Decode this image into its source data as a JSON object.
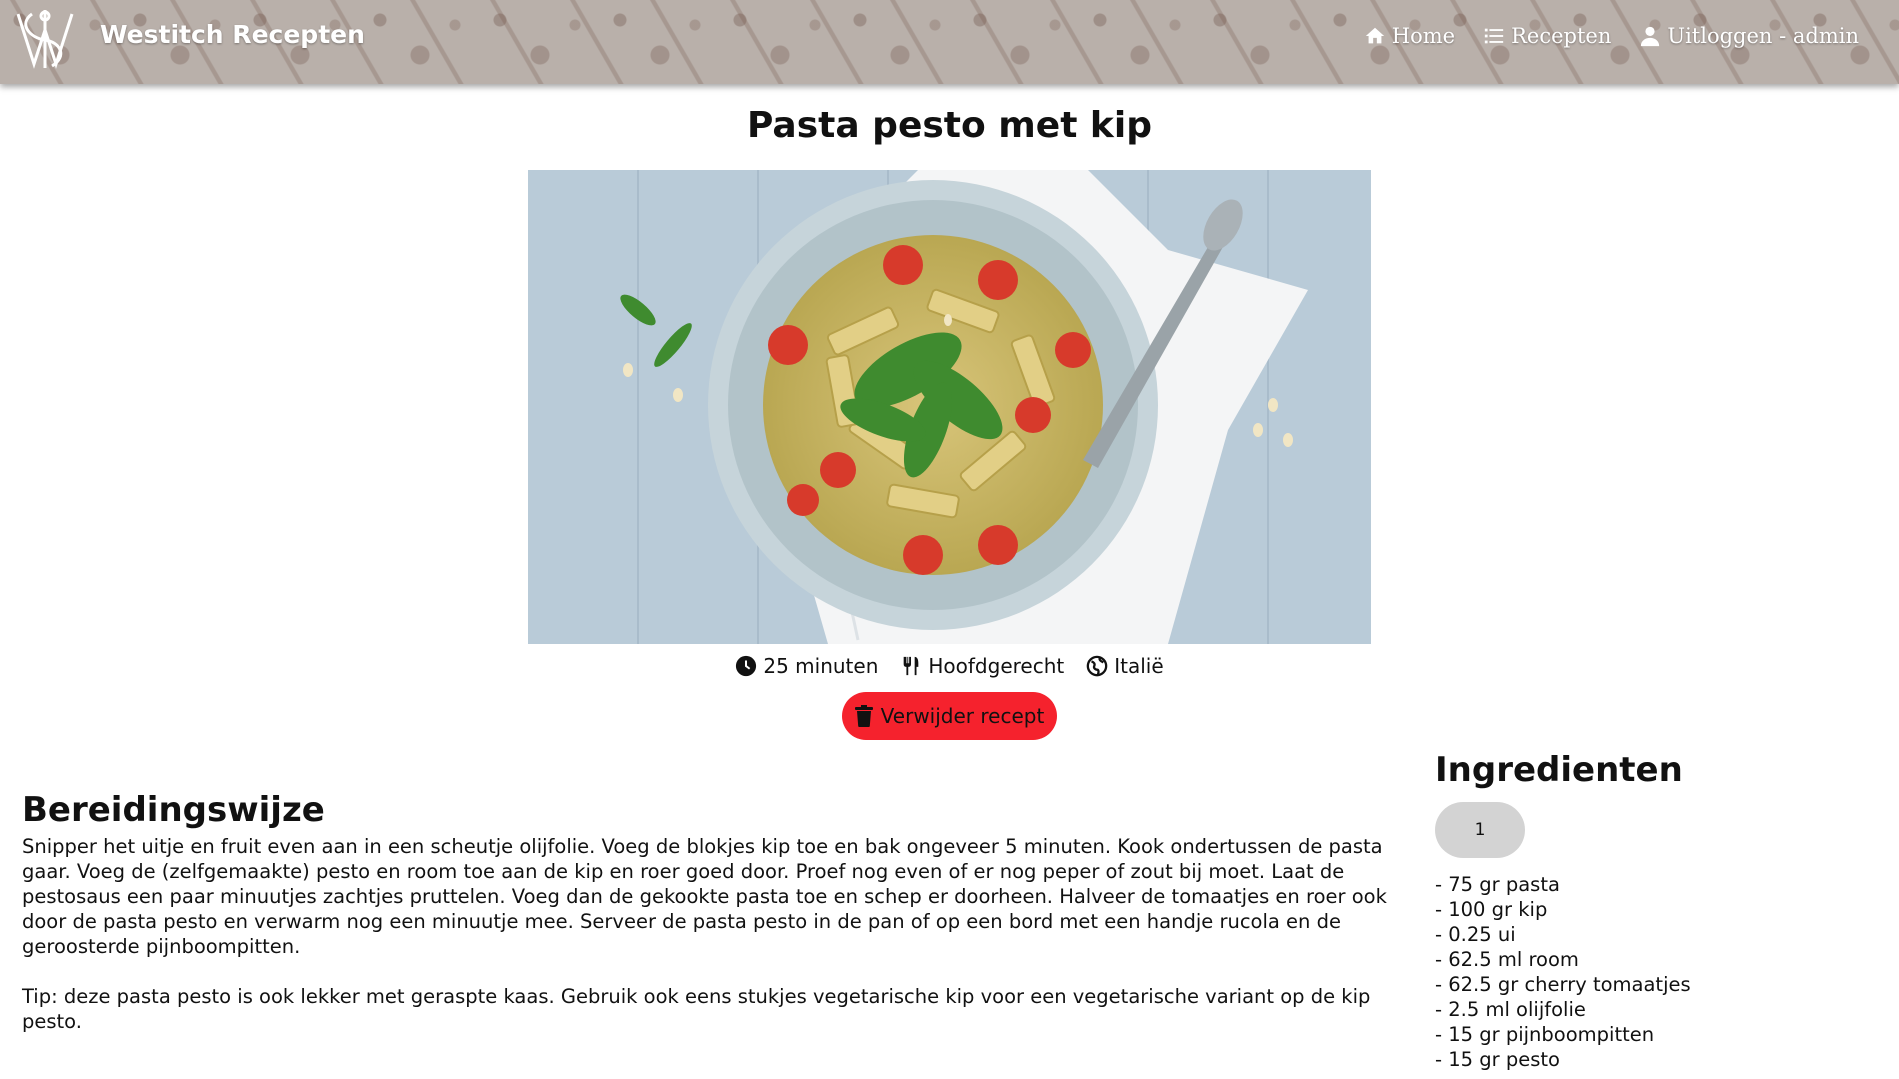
{
  "header": {
    "brand": "Westitch Recepten",
    "nav": [
      {
        "label": "Home",
        "icon": "home-icon"
      },
      {
        "label": "Recepten",
        "icon": "list-icon"
      },
      {
        "label": "Uitloggen - admin",
        "icon": "user-icon"
      }
    ]
  },
  "recipe": {
    "title": "Pasta pesto met kip",
    "time": "25 minuten",
    "course": "Hoofdgerecht",
    "cuisine": "Italië",
    "delete_label": "Verwijder recept"
  },
  "method": {
    "heading": "Bereidingswijze",
    "paragraphs": [
      "Snipper het uitje en fruit even aan in een scheutje olijfolie. Voeg de blokjes kip toe en bak ongeveer 5 minuten. Kook ondertussen de pasta gaar. Voeg de (zelfgemaakte) pesto en room toe aan de kip en roer goed door. Proef nog even of er nog peper of zout bij moet. Laat de pestosaus een paar minuutjes zachtjes pruttelen. Voeg dan de gekookte pasta toe en schep er doorheen. Halveer de tomaatjes en roer ook door de pasta pesto en verwarm nog een minuutje mee. Serveer de pasta pesto in de pan of op een bord met een handje rucola en de geroosterde pijnboompitten.",
      "Tip: deze pasta pesto is ook lekker met geraspte kaas. Gebruik ook eens stukjes vegetarische kip voor een vegetarische variant op de kip pesto."
    ]
  },
  "ingredients": {
    "heading": "Ingredienten",
    "servings": "1",
    "items": [
      "- 75 gr pasta",
      "- 100 gr kip",
      "- 0.25 ui",
      "- 62.5 ml room",
      "- 62.5 gr cherry tomaatjes",
      "- 2.5 ml olijfolie",
      "- 15 gr pijnboompitten",
      "- 15 gr pesto"
    ]
  },
  "colors": {
    "header_bg": "#b9b0aa",
    "delete_button": "#f5222d",
    "servings_bg": "#d3d3d3"
  }
}
